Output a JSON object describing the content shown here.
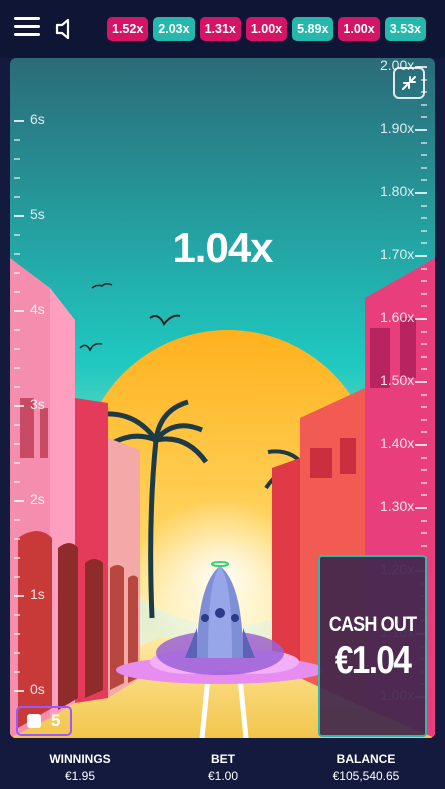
{
  "history": [
    {
      "label": "1.52x",
      "color": "#d41464"
    },
    {
      "label": "2.03x",
      "color": "#26b8ad"
    },
    {
      "label": "1.31x",
      "color": "#d41464"
    },
    {
      "label": "1.00x",
      "color": "#d41464"
    },
    {
      "label": "5.89x",
      "color": "#26b8ad"
    },
    {
      "label": "1.00x",
      "color": "#d41464"
    },
    {
      "label": "3.53x",
      "color": "#26b8ad"
    }
  ],
  "game": {
    "multiplier": "1.04x",
    "time_ticks": [
      "6s",
      "5s",
      "4s",
      "3s",
      "2s",
      "1s",
      "0s"
    ],
    "multiplier_ticks": [
      "2.00x",
      "1.90x",
      "1.80x",
      "1.70x",
      "1.60x",
      "1.50x",
      "1.40x",
      "1.30x",
      "1.20x",
      "1.10x",
      "1.00x"
    ],
    "auto_count": "5"
  },
  "cashout": {
    "label": "CASH OUT",
    "amount": "€1.04"
  },
  "footer": {
    "winnings_label": "WINNINGS",
    "winnings_value": "€1.95",
    "bet_label": "BET",
    "bet_value": "€1.00",
    "balance_label": "BALANCE",
    "balance_value": "€105,540.65"
  },
  "colors": {
    "sky_top": "#2b6b78",
    "sky_mid": "#1fc9c0",
    "sun": "#ffb11e",
    "cashout_border": "#34b7a6",
    "auto_border": "#9a58ff"
  },
  "icons": [
    "hamburger-menu-icon",
    "sound-icon",
    "collapse-icon",
    "checkbox-icon",
    "rocket-icon"
  ]
}
